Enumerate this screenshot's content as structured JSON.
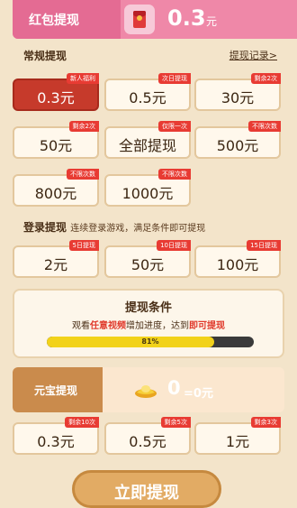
{
  "header": {
    "title": "红包提现",
    "amount": "0.3",
    "unit": "元",
    "icon": "red-envelope-icon"
  },
  "regular": {
    "label": "常规提现",
    "record_link": "提现记录>",
    "options": [
      {
        "value": "0.3元",
        "tag": "新人福利",
        "selected": true
      },
      {
        "value": "0.5元",
        "tag": "次日提现"
      },
      {
        "value": "30元",
        "tag": "剩余2次"
      },
      {
        "value": "50元",
        "tag": "剩余2次"
      },
      {
        "value": "全部提现",
        "tag": "仅限一次"
      },
      {
        "value": "500元",
        "tag": "不限次数"
      },
      {
        "value": "800元",
        "tag": "不限次数"
      },
      {
        "value": "1000元",
        "tag": "不限次数"
      }
    ]
  },
  "login": {
    "label": "登录提现",
    "sublabel": "连续登录游戏，满足条件即可提现",
    "options": [
      {
        "value": "2元",
        "tag": "5日提现"
      },
      {
        "value": "50元",
        "tag": "10日提现"
      },
      {
        "value": "100元",
        "tag": "15日提现"
      }
    ]
  },
  "condition": {
    "title": "提现条件",
    "desc_1": "观看",
    "desc_2": "任意视频",
    "desc_3": "增加进度，达到",
    "desc_4": "即可提现",
    "progress": 0.81,
    "progress_text": "81%"
  },
  "yuanbao": {
    "title": "元宝提现",
    "count": "0",
    "equals": "=0元",
    "icon": "gold-ingot-icon",
    "options": [
      {
        "value": "0.3元",
        "tag": "剩余10次"
      },
      {
        "value": "0.5元",
        "tag": "剩余5次"
      },
      {
        "value": "1元",
        "tag": "剩余3次"
      }
    ]
  },
  "submit_label": "立即提现"
}
